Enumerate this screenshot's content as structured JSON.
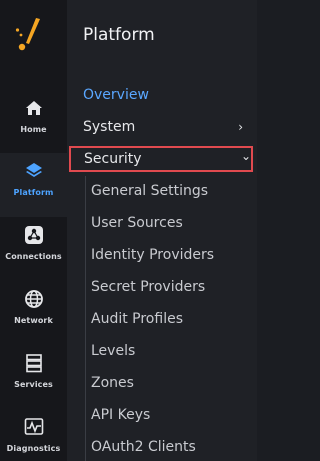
{
  "rail": {
    "items": [
      {
        "label": "Home",
        "icon": "home-icon"
      },
      {
        "label": "Platform",
        "icon": "layers-icon"
      },
      {
        "label": "Connections",
        "icon": "connections-icon"
      },
      {
        "label": "Network",
        "icon": "globe-icon"
      },
      {
        "label": "Services",
        "icon": "server-icon"
      },
      {
        "label": "Diagnostics",
        "icon": "pulse-icon"
      }
    ],
    "active": "Platform"
  },
  "panel": {
    "title": "Platform",
    "nav": [
      {
        "label": "Overview"
      },
      {
        "label": "System",
        "chevron": "›"
      },
      {
        "label": "Security",
        "chevron": "⌄"
      }
    ],
    "security_items": [
      "General Settings",
      "User Sources",
      "Identity Providers",
      "Secret Providers",
      "Audit Profiles",
      "Levels",
      "Zones",
      "API Keys",
      "OAuth2 Clients"
    ]
  },
  "colors": {
    "accent": "#4da3ff",
    "highlight_border": "#e04a4f",
    "logo": "#f5a623"
  }
}
